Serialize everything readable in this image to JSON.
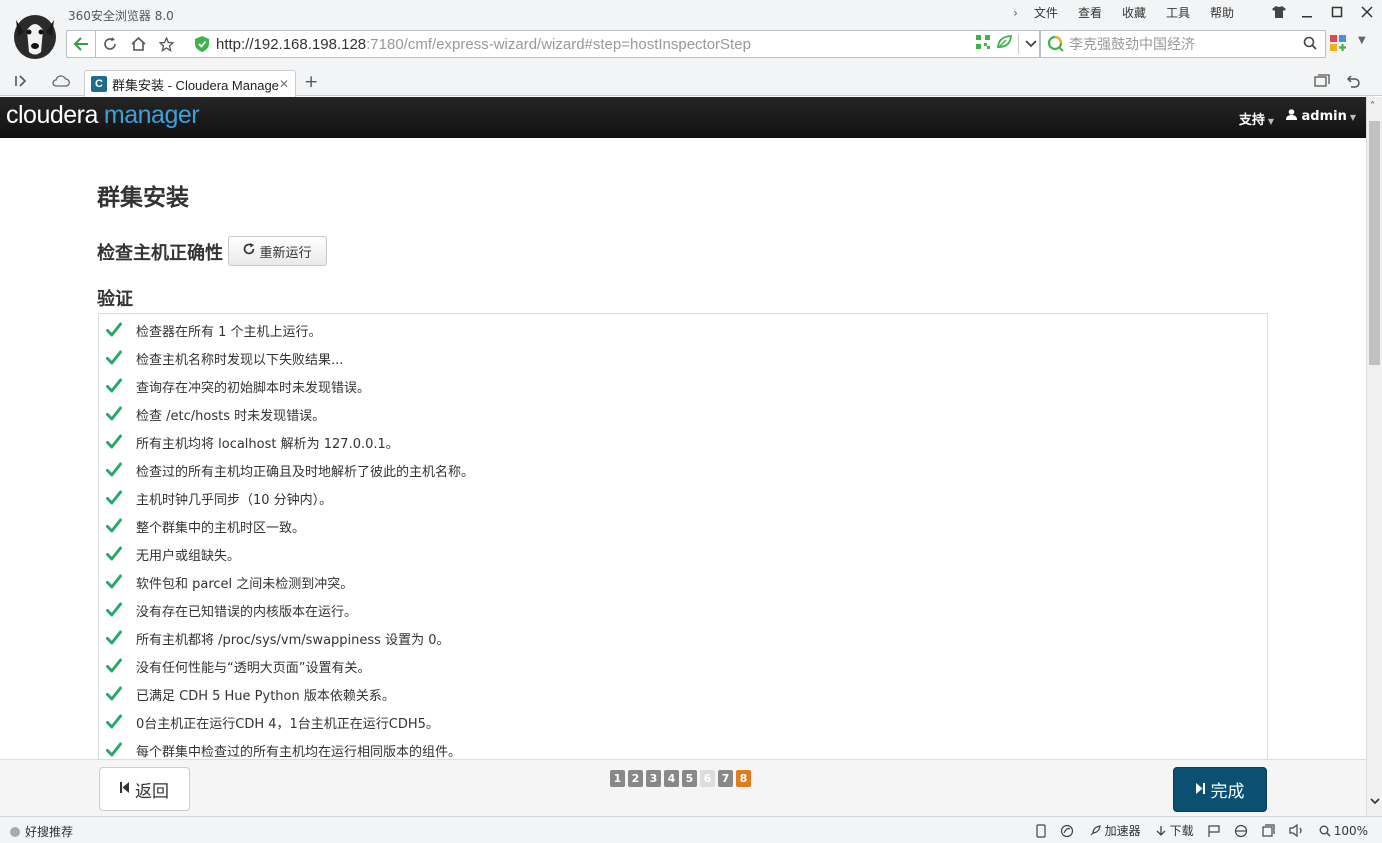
{
  "browser": {
    "title": "360安全浏览器 8.0",
    "menu": {
      "file": "文件",
      "view": "查看",
      "favorites": "收藏",
      "tools": "工具",
      "help": "帮助"
    },
    "url": {
      "host": "http://192.168.198.128",
      "rest": ":7180/cmf/express-wizard/wizard#step=hostInspectorStep"
    },
    "search_placeholder": "李克强鼓劲中国经济",
    "tab_title": "群集安装 - Cloudera Manage",
    "statusbar": {
      "left": "好搜推荐",
      "accelerator": "加速器",
      "download": "下载",
      "zoom": "100%"
    }
  },
  "app": {
    "logo": {
      "part1": "cloudera",
      "part2": "manager"
    },
    "nav": {
      "support": "支持",
      "user": "admin"
    },
    "page_title": "群集安装",
    "section_title": "检查主机正确性",
    "rerun_label": "重新运行",
    "validation_title": "验证",
    "checks": [
      "检查器在所有 1 个主机上运行。",
      "检查主机名称时发现以下失败结果...",
      "查询存在冲突的初始脚本时未发现错误。",
      "检查 /etc/hosts 时未发现错误。",
      "所有主机均将 localhost 解析为 127.0.0.1。",
      "检查过的所有主机均正确且及时地解析了彼此的主机名称。",
      "主机时钟几乎同步（10 分钟内）。",
      "整个群集中的主机时区一致。",
      "无用户或组缺失。",
      "软件包和 parcel 之间未检测到冲突。",
      "没有存在已知错误的内核版本在运行。",
      "所有主机都将 /proc/sys/vm/swappiness 设置为 0。",
      "没有任何性能与“透明大页面”设置有关。",
      "已满足 CDH 5 Hue Python 版本依赖关系。",
      "0台主机正在运行CDH 4，1台主机正在运行CDH5。",
      "每个群集中检查过的所有主机均在运行相同版本的组件。"
    ],
    "footer": {
      "back_label": "返回",
      "finish_label": "完成",
      "steps": [
        "1",
        "2",
        "3",
        "4",
        "5",
        "6",
        "7",
        "8"
      ],
      "current_step": "8"
    }
  },
  "colors": {
    "check_green": "#28a86a",
    "accent_blue": "#3f9fd9",
    "finish_bg": "#0b4f71",
    "current_step": "#e07b22"
  }
}
